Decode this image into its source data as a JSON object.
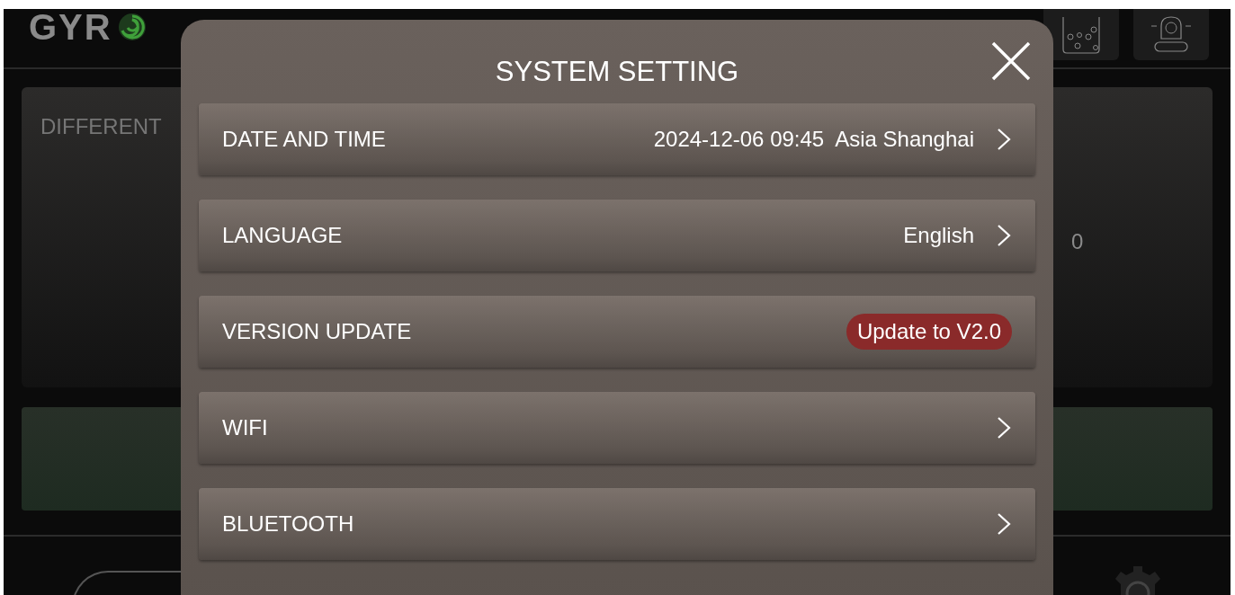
{
  "header": {
    "logo_text": "GYR"
  },
  "panel": {
    "title_partial": "DIFFERENT",
    "value_partial": "0"
  },
  "dialog": {
    "title": "SYSTEM SETTING",
    "rows": [
      {
        "kind": "link",
        "label": "DATE AND TIME",
        "value": "2024-12-06 09:45  Asia Shanghai"
      },
      {
        "kind": "link",
        "label": "LANGUAGE",
        "value": "English"
      },
      {
        "kind": "badge",
        "label": "VERSION UPDATE",
        "value": "Update to V2.0"
      },
      {
        "kind": "link",
        "label": "WIFI"
      },
      {
        "kind": "link",
        "label": "BLUETOOTH"
      }
    ]
  }
}
